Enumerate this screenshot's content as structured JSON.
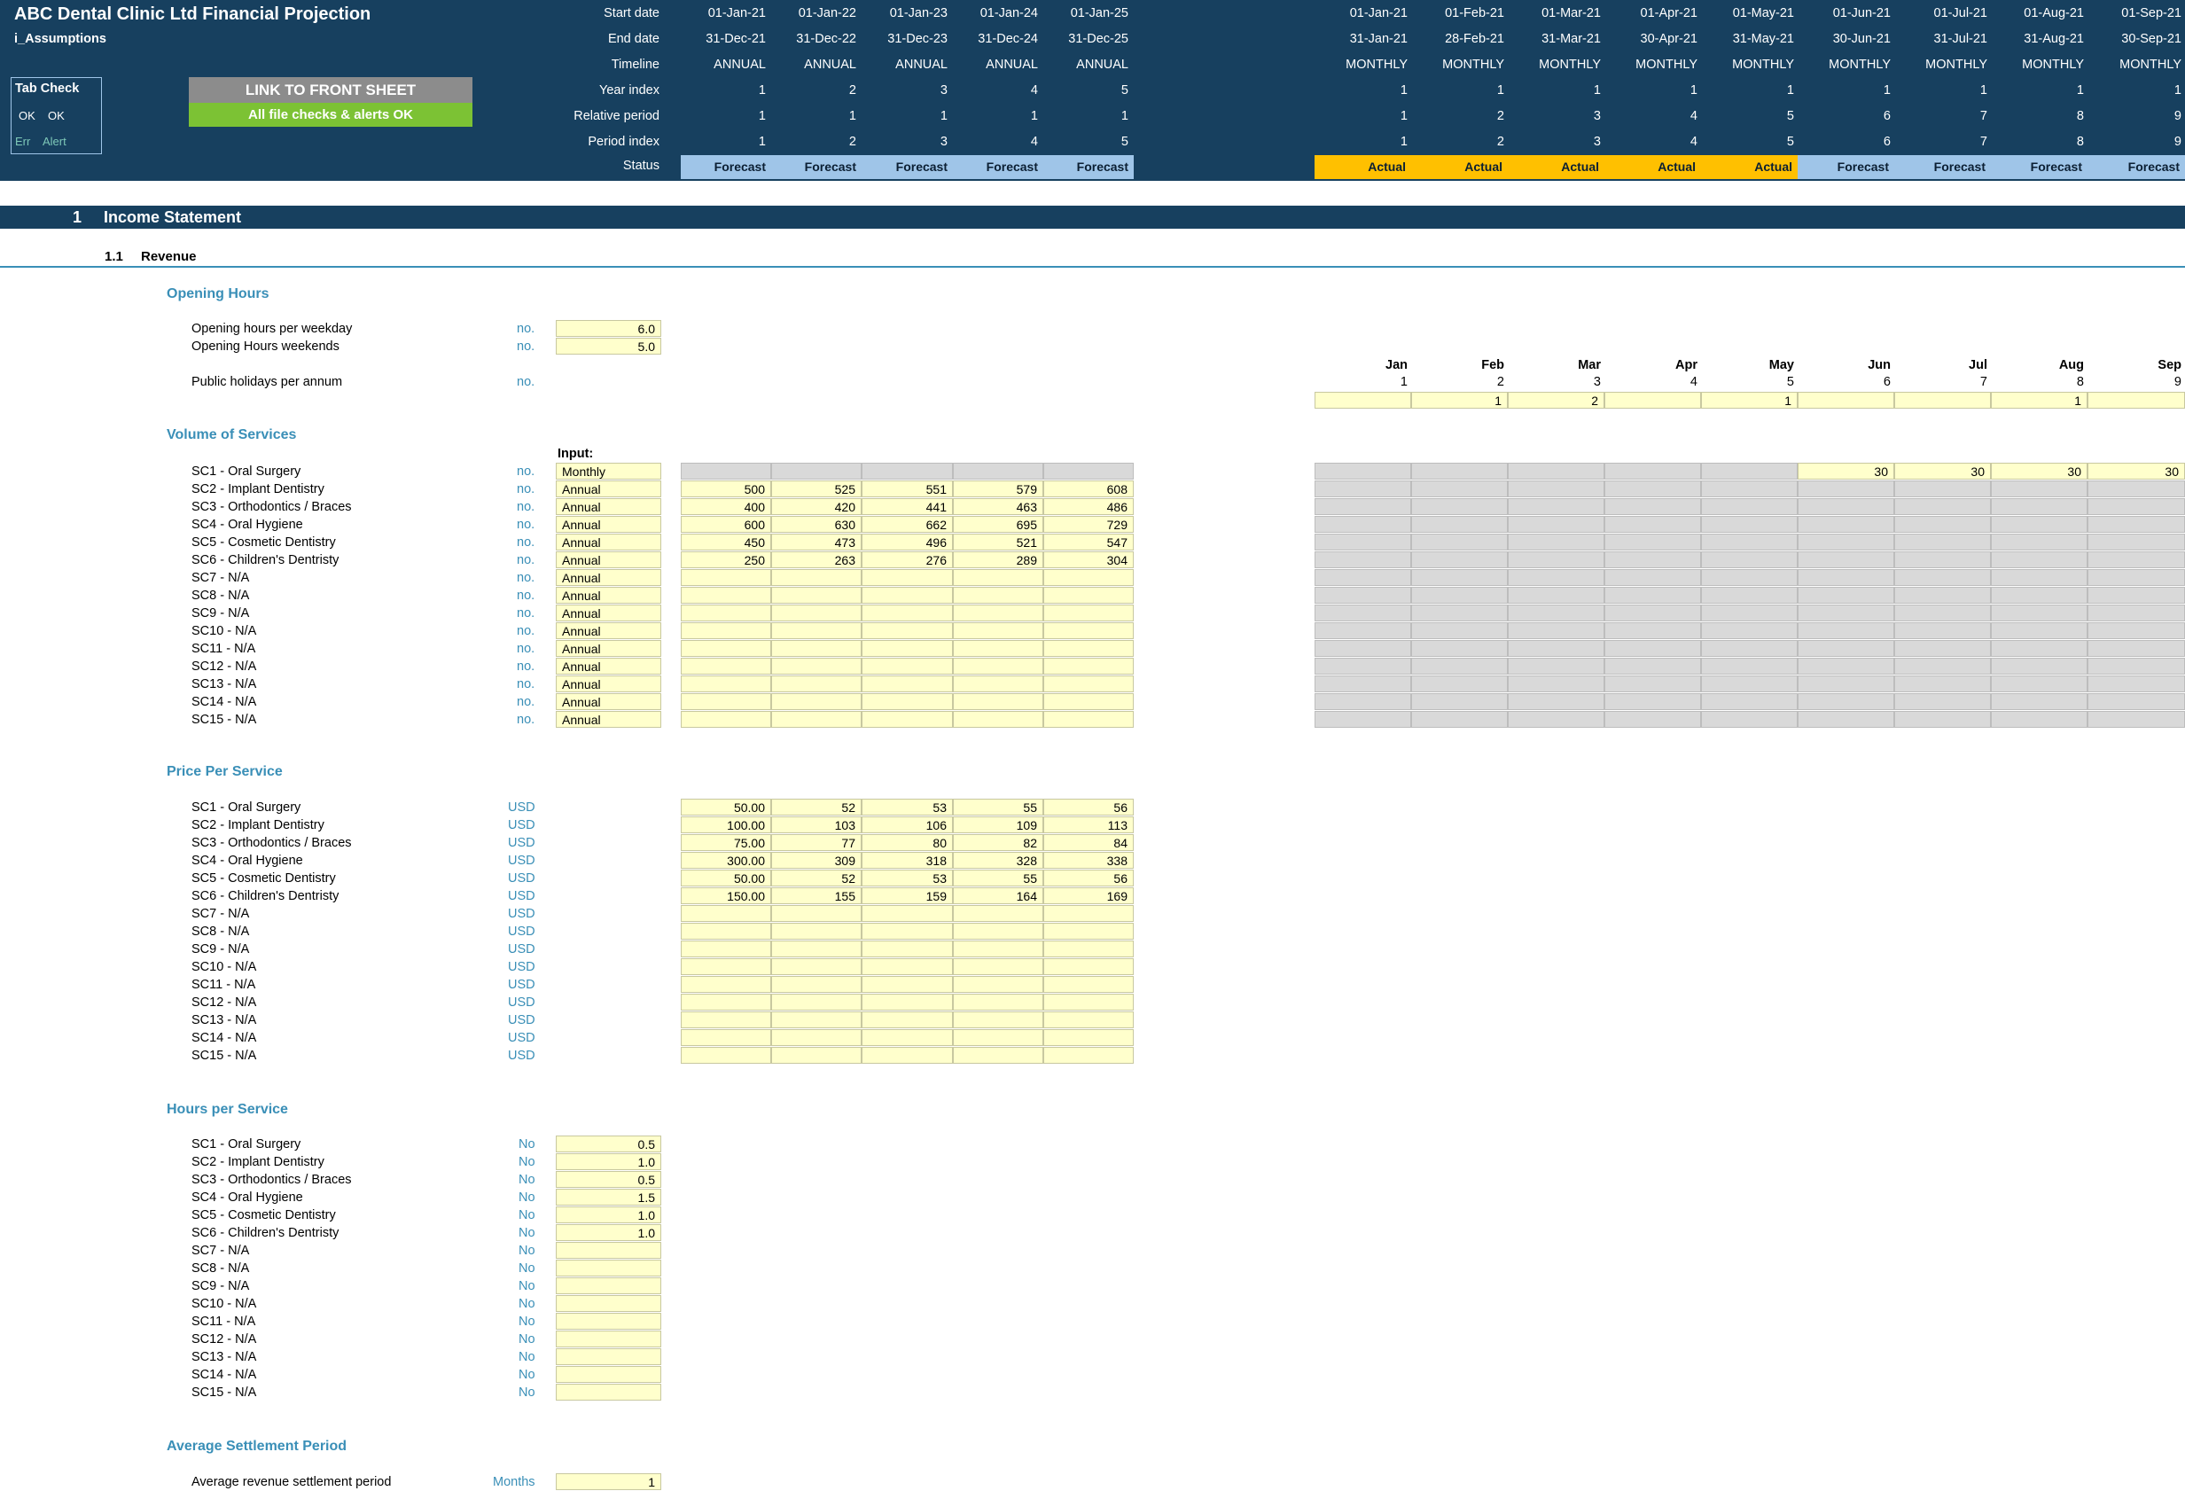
{
  "header": {
    "title": "ABC Dental Clinic Ltd Financial Projection",
    "sheet": "i_Assumptions",
    "tab_check": {
      "title": "Tab Check",
      "ok1": "OK",
      "ok2": "OK",
      "err": "Err",
      "alert": "Alert"
    },
    "link_button": "LINK TO FRONT SHEET",
    "checks_button": "All file checks & alerts OK",
    "row_labels": [
      "Start date",
      "End date",
      "Timeline",
      "Year index",
      "Relative period",
      "Period index",
      "Status"
    ],
    "annual": [
      {
        "start": "01-Jan-21",
        "end": "31-Dec-21",
        "timeline": "ANNUAL",
        "year": "1",
        "rel": "1",
        "period": "1",
        "status": "Forecast"
      },
      {
        "start": "01-Jan-22",
        "end": "31-Dec-22",
        "timeline": "ANNUAL",
        "year": "2",
        "rel": "1",
        "period": "2",
        "status": "Forecast"
      },
      {
        "start": "01-Jan-23",
        "end": "31-Dec-23",
        "timeline": "ANNUAL",
        "year": "3",
        "rel": "1",
        "period": "3",
        "status": "Forecast"
      },
      {
        "start": "01-Jan-24",
        "end": "31-Dec-24",
        "timeline": "ANNUAL",
        "year": "4",
        "rel": "1",
        "period": "4",
        "status": "Forecast"
      },
      {
        "start": "01-Jan-25",
        "end": "31-Dec-25",
        "timeline": "ANNUAL",
        "year": "5",
        "rel": "1",
        "period": "5",
        "status": "Forecast"
      }
    ],
    "monthly": [
      {
        "start": "01-Jan-21",
        "end": "31-Jan-21",
        "timeline": "MONTHLY",
        "year": "1",
        "rel": "1",
        "period": "1",
        "status": "Actual"
      },
      {
        "start": "01-Feb-21",
        "end": "28-Feb-21",
        "timeline": "MONTHLY",
        "year": "1",
        "rel": "2",
        "period": "2",
        "status": "Actual"
      },
      {
        "start": "01-Mar-21",
        "end": "31-Mar-21",
        "timeline": "MONTHLY",
        "year": "1",
        "rel": "3",
        "period": "3",
        "status": "Actual"
      },
      {
        "start": "01-Apr-21",
        "end": "30-Apr-21",
        "timeline": "MONTHLY",
        "year": "1",
        "rel": "4",
        "period": "4",
        "status": "Actual"
      },
      {
        "start": "01-May-21",
        "end": "31-May-21",
        "timeline": "MONTHLY",
        "year": "1",
        "rel": "5",
        "period": "5",
        "status": "Actual"
      },
      {
        "start": "01-Jun-21",
        "end": "30-Jun-21",
        "timeline": "MONTHLY",
        "year": "1",
        "rel": "6",
        "period": "6",
        "status": "Forecast"
      },
      {
        "start": "01-Jul-21",
        "end": "31-Jul-21",
        "timeline": "MONTHLY",
        "year": "1",
        "rel": "7",
        "period": "7",
        "status": "Forecast"
      },
      {
        "start": "01-Aug-21",
        "end": "31-Aug-21",
        "timeline": "MONTHLY",
        "year": "1",
        "rel": "8",
        "period": "8",
        "status": "Forecast"
      },
      {
        "start": "01-Sep-21",
        "end": "30-Sep-21",
        "timeline": "MONTHLY",
        "year": "1",
        "rel": "9",
        "period": "9",
        "status": "Forecast"
      }
    ]
  },
  "section": {
    "num": "1",
    "title": "Income Statement"
  },
  "subsection": {
    "num": "1.1",
    "title": "Revenue"
  },
  "opening_hours": {
    "title": "Opening Hours",
    "rows": [
      {
        "label": "Opening hours per weekday",
        "unit": "no.",
        "value": "6.0"
      },
      {
        "label": "Opening Hours weekends",
        "unit": "no.",
        "value": "5.0"
      }
    ],
    "holidays_label": "Public holidays per annum",
    "holidays_unit": "no.",
    "months": [
      "Jan",
      "Feb",
      "Mar",
      "Apr",
      "May",
      "Jun",
      "Jul",
      "Aug",
      "Sep"
    ],
    "month_nums": [
      "1",
      "2",
      "3",
      "4",
      "5",
      "6",
      "7",
      "8",
      "9"
    ],
    "holidays": [
      "",
      "1",
      "2",
      "",
      "1",
      "",
      "",
      "1",
      ""
    ]
  },
  "volume": {
    "title": "Volume of Services",
    "input_label": "Input:",
    "rows": [
      {
        "label": "SC1 - Oral Surgery",
        "unit": "no.",
        "freq": "Monthly",
        "annual": [
          "",
          "",
          "",
          "",
          ""
        ],
        "monthly": [
          "",
          "",
          "",
          "",
          "",
          "30",
          "30",
          "30",
          "30"
        ]
      },
      {
        "label": "SC2 - Implant Dentistry",
        "unit": "no.",
        "freq": "Annual",
        "annual": [
          "500",
          "525",
          "551",
          "579",
          "608"
        ],
        "monthly": []
      },
      {
        "label": "SC3 - Orthodontics / Braces",
        "unit": "no.",
        "freq": "Annual",
        "annual": [
          "400",
          "420",
          "441",
          "463",
          "486"
        ],
        "monthly": []
      },
      {
        "label": "SC4 - Oral Hygiene",
        "unit": "no.",
        "freq": "Annual",
        "annual": [
          "600",
          "630",
          "662",
          "695",
          "729"
        ],
        "monthly": []
      },
      {
        "label": "SC5 - Cosmetic Dentistry",
        "unit": "no.",
        "freq": "Annual",
        "annual": [
          "450",
          "473",
          "496",
          "521",
          "547"
        ],
        "monthly": []
      },
      {
        "label": "SC6 - Children's Dentristy",
        "unit": "no.",
        "freq": "Annual",
        "annual": [
          "250",
          "263",
          "276",
          "289",
          "304"
        ],
        "monthly": []
      },
      {
        "label": "SC7 - N/A",
        "unit": "no.",
        "freq": "Annual",
        "annual": [],
        "monthly": []
      },
      {
        "label": "SC8 - N/A",
        "unit": "no.",
        "freq": "Annual",
        "annual": [],
        "monthly": []
      },
      {
        "label": "SC9 - N/A",
        "unit": "no.",
        "freq": "Annual",
        "annual": [],
        "monthly": []
      },
      {
        "label": "SC10 - N/A",
        "unit": "no.",
        "freq": "Annual",
        "annual": [],
        "monthly": []
      },
      {
        "label": "SC11 - N/A",
        "unit": "no.",
        "freq": "Annual",
        "annual": [],
        "monthly": []
      },
      {
        "label": "SC12 - N/A",
        "unit": "no.",
        "freq": "Annual",
        "annual": [],
        "monthly": []
      },
      {
        "label": "SC13 - N/A",
        "unit": "no.",
        "freq": "Annual",
        "annual": [],
        "monthly": []
      },
      {
        "label": "SC14 - N/A",
        "unit": "no.",
        "freq": "Annual",
        "annual": [],
        "monthly": []
      },
      {
        "label": "SC15 - N/A",
        "unit": "no.",
        "freq": "Annual",
        "annual": [],
        "monthly": []
      }
    ]
  },
  "price": {
    "title": "Price Per Service",
    "rows": [
      {
        "label": "SC1 - Oral Surgery",
        "unit": "USD",
        "annual": [
          "50.00",
          "52",
          "53",
          "55",
          "56"
        ]
      },
      {
        "label": "SC2 - Implant Dentistry",
        "unit": "USD",
        "annual": [
          "100.00",
          "103",
          "106",
          "109",
          "113"
        ]
      },
      {
        "label": "SC3 - Orthodontics / Braces",
        "unit": "USD",
        "annual": [
          "75.00",
          "77",
          "80",
          "82",
          "84"
        ]
      },
      {
        "label": "SC4 - Oral Hygiene",
        "unit": "USD",
        "annual": [
          "300.00",
          "309",
          "318",
          "328",
          "338"
        ]
      },
      {
        "label": "SC5 - Cosmetic Dentistry",
        "unit": "USD",
        "annual": [
          "50.00",
          "52",
          "53",
          "55",
          "56"
        ]
      },
      {
        "label": "SC6 - Children's Dentristy",
        "unit": "USD",
        "annual": [
          "150.00",
          "155",
          "159",
          "164",
          "169"
        ]
      },
      {
        "label": "SC7 - N/A",
        "unit": "USD",
        "annual": []
      },
      {
        "label": "SC8 - N/A",
        "unit": "USD",
        "annual": []
      },
      {
        "label": "SC9 - N/A",
        "unit": "USD",
        "annual": []
      },
      {
        "label": "SC10 - N/A",
        "unit": "USD",
        "annual": []
      },
      {
        "label": "SC11 - N/A",
        "unit": "USD",
        "annual": []
      },
      {
        "label": "SC12 - N/A",
        "unit": "USD",
        "annual": []
      },
      {
        "label": "SC13 - N/A",
        "unit": "USD",
        "annual": []
      },
      {
        "label": "SC14 - N/A",
        "unit": "USD",
        "annual": []
      },
      {
        "label": "SC15 - N/A",
        "unit": "USD",
        "annual": []
      }
    ]
  },
  "hours": {
    "title": "Hours per Service",
    "rows": [
      {
        "label": "SC1 - Oral Surgery",
        "unit": "No",
        "value": "0.5"
      },
      {
        "label": "SC2 - Implant Dentistry",
        "unit": "No",
        "value": "1.0"
      },
      {
        "label": "SC3 - Orthodontics / Braces",
        "unit": "No",
        "value": "0.5"
      },
      {
        "label": "SC4 - Oral Hygiene",
        "unit": "No",
        "value": "1.5"
      },
      {
        "label": "SC5 - Cosmetic Dentistry",
        "unit": "No",
        "value": "1.0"
      },
      {
        "label": "SC6 - Children's Dentristy",
        "unit": "No",
        "value": "1.0"
      },
      {
        "label": "SC7 - N/A",
        "unit": "No",
        "value": ""
      },
      {
        "label": "SC8 - N/A",
        "unit": "No",
        "value": ""
      },
      {
        "label": "SC9 - N/A",
        "unit": "No",
        "value": ""
      },
      {
        "label": "SC10 - N/A",
        "unit": "No",
        "value": ""
      },
      {
        "label": "SC11 - N/A",
        "unit": "No",
        "value": ""
      },
      {
        "label": "SC12 - N/A",
        "unit": "No",
        "value": ""
      },
      {
        "label": "SC13 - N/A",
        "unit": "No",
        "value": ""
      },
      {
        "label": "SC14 - N/A",
        "unit": "No",
        "value": ""
      },
      {
        "label": "SC15 - N/A",
        "unit": "No",
        "value": ""
      }
    ]
  },
  "settlement": {
    "title": "Average Settlement Period",
    "label": "Average revenue settlement period",
    "unit": "Months",
    "value": "1"
  },
  "colors": {
    "header": "#17405f",
    "accent": "#3a8fb7",
    "input": "#ffffcc",
    "forecast": "#9fc5e8",
    "actual": "#ffc000",
    "ok": "#7cc234"
  }
}
